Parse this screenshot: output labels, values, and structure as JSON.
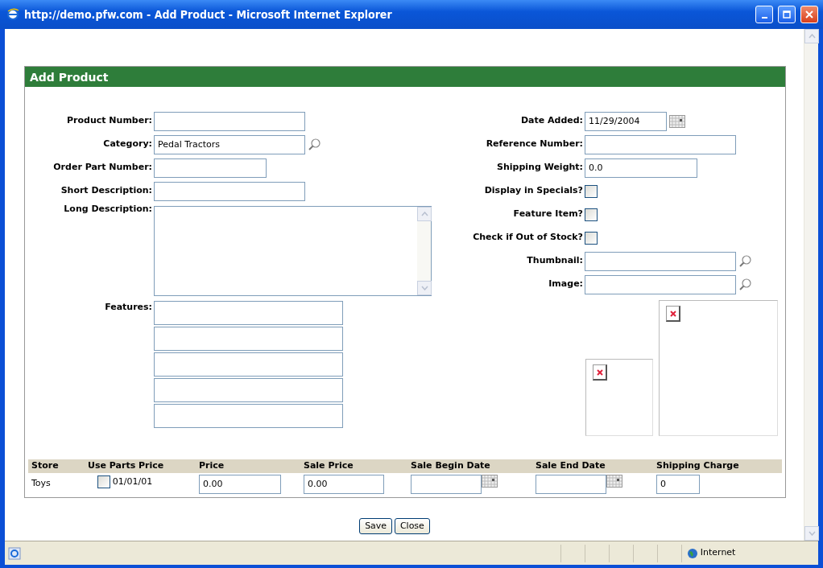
{
  "window": {
    "title": "http://demo.pfw.com - Add Product - Microsoft Internet Explorer"
  },
  "panel": {
    "title": "Add Product"
  },
  "left_fields": [
    {
      "kind": "text",
      "label": "Product Number:"
    },
    {
      "kind": "lookup",
      "label": "Category:",
      "value": "Pedal Tractors"
    },
    {
      "kind": "short",
      "label": "Order Part Number:"
    },
    {
      "kind": "text",
      "label": "Short Description:"
    },
    {
      "kind": "textarea",
      "label": "Long Description:"
    }
  ],
  "features": {
    "label": "Features:",
    "fields": [
      {
        "kind": "text"
      },
      {
        "kind": "text"
      },
      {
        "kind": "text"
      },
      {
        "kind": "text"
      },
      {
        "kind": "text"
      }
    ]
  },
  "right_fields": [
    {
      "kind": "date",
      "label": "Date Added:",
      "value": "11/29/2004"
    },
    {
      "kind": "text",
      "label": "Reference Number:"
    },
    {
      "kind": "short",
      "label": "Shipping Weight:",
      "value": "0.0"
    },
    {
      "kind": "checkbox",
      "label": "Display in Specials?",
      "checked": false
    },
    {
      "kind": "checkbox",
      "label": "Feature Item?",
      "checked": false
    },
    {
      "kind": "checkbox",
      "label": "Check if Out of Stock?",
      "checked": false
    },
    {
      "kind": "lookup",
      "label": "Thumbnail:"
    },
    {
      "kind": "lookup",
      "label": "Image:"
    }
  ],
  "image_previews": [
    {
      "kind": "thumbnail"
    },
    {
      "kind": "image"
    }
  ],
  "pricing": {
    "columns": [
      "Store",
      "Use Parts Price",
      "Price",
      "Sale Price",
      "Sale Begin Date",
      "Sale End Date",
      "Shipping Charge"
    ],
    "rows": [
      {
        "store": "Toys",
        "use_parts_price": false,
        "parts_price": "01/01/01",
        "price": "0.00",
        "sale_price": "0.00",
        "shipping_charge": "0"
      }
    ]
  },
  "buttons": [
    "Save",
    "Close"
  ],
  "status_bar": {
    "zone": "Internet"
  }
}
